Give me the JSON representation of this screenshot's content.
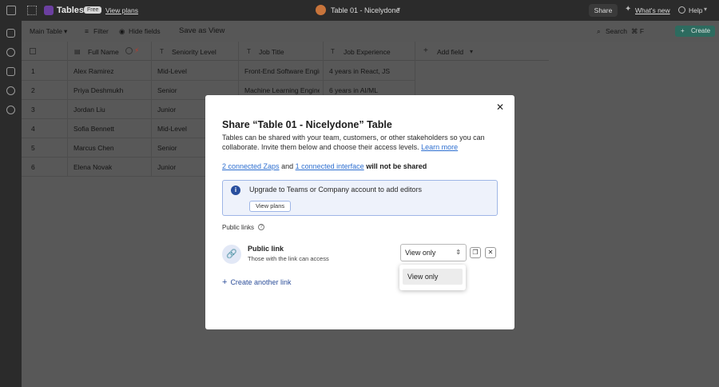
{
  "topbar": {
    "app_title": "Tables",
    "badge": "Free",
    "view_plans": "View plans",
    "doc_title": "Table 01 - Nicelydone",
    "share": "Share",
    "whats_new": "What's new",
    "help": "Help"
  },
  "toolbar": {
    "view_name": "Main Table",
    "filter": "Filter",
    "hide_fields": "Hide fields",
    "save_as_view": "Save as View",
    "search": "Search",
    "search_shortcut": "⌘ F",
    "create": "Create"
  },
  "table": {
    "columns": [
      "Full Name",
      "Seniority Level",
      "Job Title",
      "Job Experience"
    ],
    "add_field": "Add field",
    "rows": [
      {
        "id": "1",
        "name": "Alex Ramirez",
        "level": "Mid-Level",
        "title": "Front-End Software Engineer",
        "exp": "4 years in React, JS"
      },
      {
        "id": "2",
        "name": "Priya Deshmukh",
        "level": "Senior",
        "title": "Machine Learning Engineer",
        "exp": "6 years in AI/ML"
      },
      {
        "id": "3",
        "name": "Jordan Liu",
        "level": "Junior",
        "title": "",
        "exp": ""
      },
      {
        "id": "4",
        "name": "Sofia Bennett",
        "level": "Mid-Level",
        "title": "",
        "exp": ""
      },
      {
        "id": "5",
        "name": "Marcus Chen",
        "level": "Senior",
        "title": "",
        "exp": ""
      },
      {
        "id": "6",
        "name": "Elena Novak",
        "level": "Junior",
        "title": "",
        "exp": ""
      }
    ]
  },
  "modal": {
    "title": "Share “Table 01 - Nicelydone” Table",
    "description": "Tables can be shared with your team, customers, or other stakeholders so you can collaborate. Invite them below and choose their access levels.",
    "learn_more": "Learn more",
    "zaps_link": "2 connected Zaps",
    "and": "and",
    "interface_link": "1 connected interface",
    "not_shared": "will not be shared",
    "info_text": "Upgrade to Teams or Company account to add editors",
    "info_button": "View plans",
    "public_links_label": "Public links",
    "public_link_title": "Public link",
    "public_link_sub": "Those with the link can access",
    "permission_selected": "View only",
    "dropdown_option": "View only",
    "create_another": "Create another link"
  }
}
